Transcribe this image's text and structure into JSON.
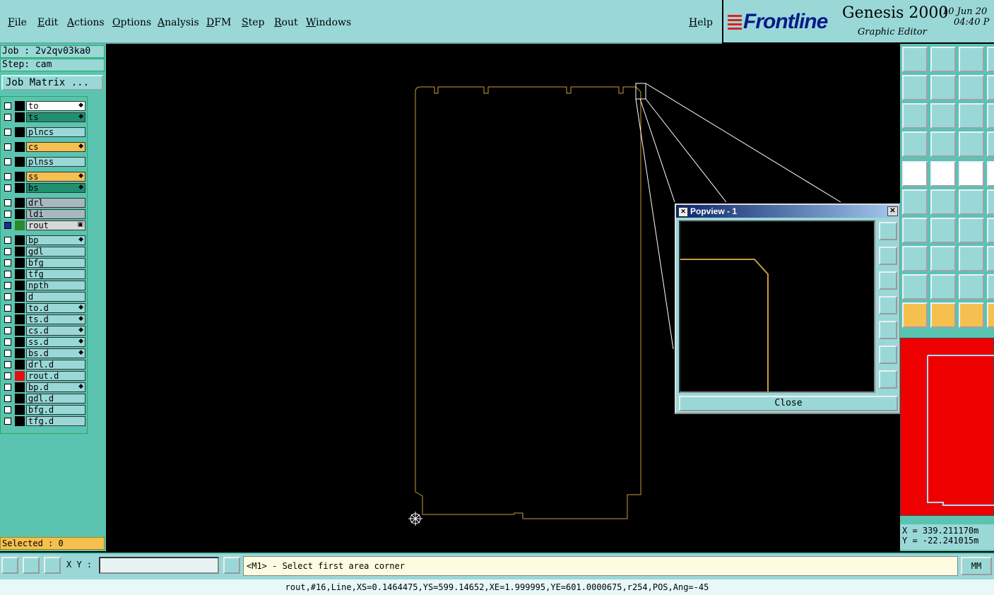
{
  "menu": {
    "items": [
      "File",
      "Edit",
      "Actions",
      "Options",
      "Analysis",
      "DFM",
      "Step",
      "Rout",
      "Windows"
    ],
    "help": "Help"
  },
  "brand": {
    "logo": "Frontline",
    "product": "Genesis 2000",
    "subtitle": "Graphic Editor",
    "date_line1": "10 Jun 20",
    "date_line2": "04:40 P"
  },
  "job": {
    "job_label": "Job : 2v2qv03ka0",
    "step_label": "Step: cam",
    "matrix_button": "Job Matrix ..."
  },
  "layers": [
    {
      "name": "to",
      "color": "#ffffff",
      "mark": "◆",
      "swatch": "#000000"
    },
    {
      "name": "ts",
      "color": "#209070",
      "mark": "◆",
      "swatch": "#000000"
    },
    {
      "name": "plncs",
      "color": "#9ad8d8",
      "mark": "",
      "swatch": "#000000"
    },
    {
      "name": "cs",
      "color": "#f5c050",
      "mark": "◆",
      "swatch": "#000000"
    },
    {
      "name": "plnss",
      "color": "#9ad8d8",
      "mark": "",
      "swatch": "#000000"
    },
    {
      "name": "ss",
      "color": "#f5c050",
      "mark": "◆",
      "swatch": "#000000"
    },
    {
      "name": "bs",
      "color": "#209070",
      "mark": "◆",
      "swatch": "#000000"
    },
    {
      "name": "drl",
      "color": "#a8b8c0",
      "mark": "",
      "swatch": "#000000"
    },
    {
      "name": "ldi",
      "color": "#a8b8c0",
      "mark": "",
      "swatch": "#000000"
    },
    {
      "name": "rout",
      "color": "#d8d8d8",
      "mark": "▣",
      "swatch": "#2a8a2a",
      "checked": "#1a2a9a"
    },
    {
      "name": "bp",
      "color": "#9ad8d8",
      "mark": "◆",
      "swatch": "#000000"
    },
    {
      "name": "gdl",
      "color": "#9ad8d8",
      "mark": "",
      "swatch": "#000000"
    },
    {
      "name": "bfg",
      "color": "#9ad8d8",
      "mark": "",
      "swatch": "#000000"
    },
    {
      "name": "tfg",
      "color": "#9ad8d8",
      "mark": "",
      "swatch": "#000000"
    },
    {
      "name": "npth",
      "color": "#9ad8d8",
      "mark": "",
      "swatch": "#000000"
    },
    {
      "name": "d",
      "color": "#9ad8d8",
      "mark": "",
      "swatch": "#000000"
    },
    {
      "name": "to.d",
      "color": "#9ad8d8",
      "mark": "◆",
      "swatch": "#000000"
    },
    {
      "name": "ts.d",
      "color": "#9ad8d8",
      "mark": "◆",
      "swatch": "#000000"
    },
    {
      "name": "cs.d",
      "color": "#9ad8d8",
      "mark": "◆",
      "swatch": "#000000"
    },
    {
      "name": "ss.d",
      "color": "#9ad8d8",
      "mark": "◆",
      "swatch": "#000000"
    },
    {
      "name": "bs.d",
      "color": "#9ad8d8",
      "mark": "◆",
      "swatch": "#000000"
    },
    {
      "name": "drl.d",
      "color": "#9ad8d8",
      "mark": "",
      "swatch": "#000000"
    },
    {
      "name": "rout.d",
      "color": "#9ad8d8",
      "mark": "",
      "swatch": "#e01010"
    },
    {
      "name": "bp.d",
      "color": "#9ad8d8",
      "mark": "◆",
      "swatch": "#000000"
    },
    {
      "name": "gdl.d",
      "color": "#9ad8d8",
      "mark": "",
      "swatch": "#000000"
    },
    {
      "name": "bfg.d",
      "color": "#9ad8d8",
      "mark": "",
      "swatch": "#000000"
    },
    {
      "name": "tfg.d",
      "color": "#9ad8d8",
      "mark": "",
      "swatch": "#000000"
    }
  ],
  "selected": "Selected : 0",
  "popview": {
    "title": "Popview - 1",
    "close_button": "Close",
    "buttons": [
      "zoom-fit-icon",
      "pan-up-icon",
      "pan-down-icon",
      "pan-left-icon",
      "pan-right-icon",
      "zoom-in-icon",
      "zoom-out-icon"
    ]
  },
  "coords": {
    "x": "X = 339.211170m",
    "y": "Y = -22.241015m"
  },
  "bottom": {
    "xy_label": "X Y :",
    "xy_value": "",
    "prompt": "<M1> - Select first area corner",
    "units": "MM"
  },
  "status": "rout,#16,Line,XS=0.1464475,YS=599.14652,XE=1.999995,YE=601.0000675,r254,POS,Ang=-45",
  "colors": {
    "rout_line": "#c89a40",
    "overview_bg": "#e00000",
    "panel": "#9ad8d8"
  }
}
